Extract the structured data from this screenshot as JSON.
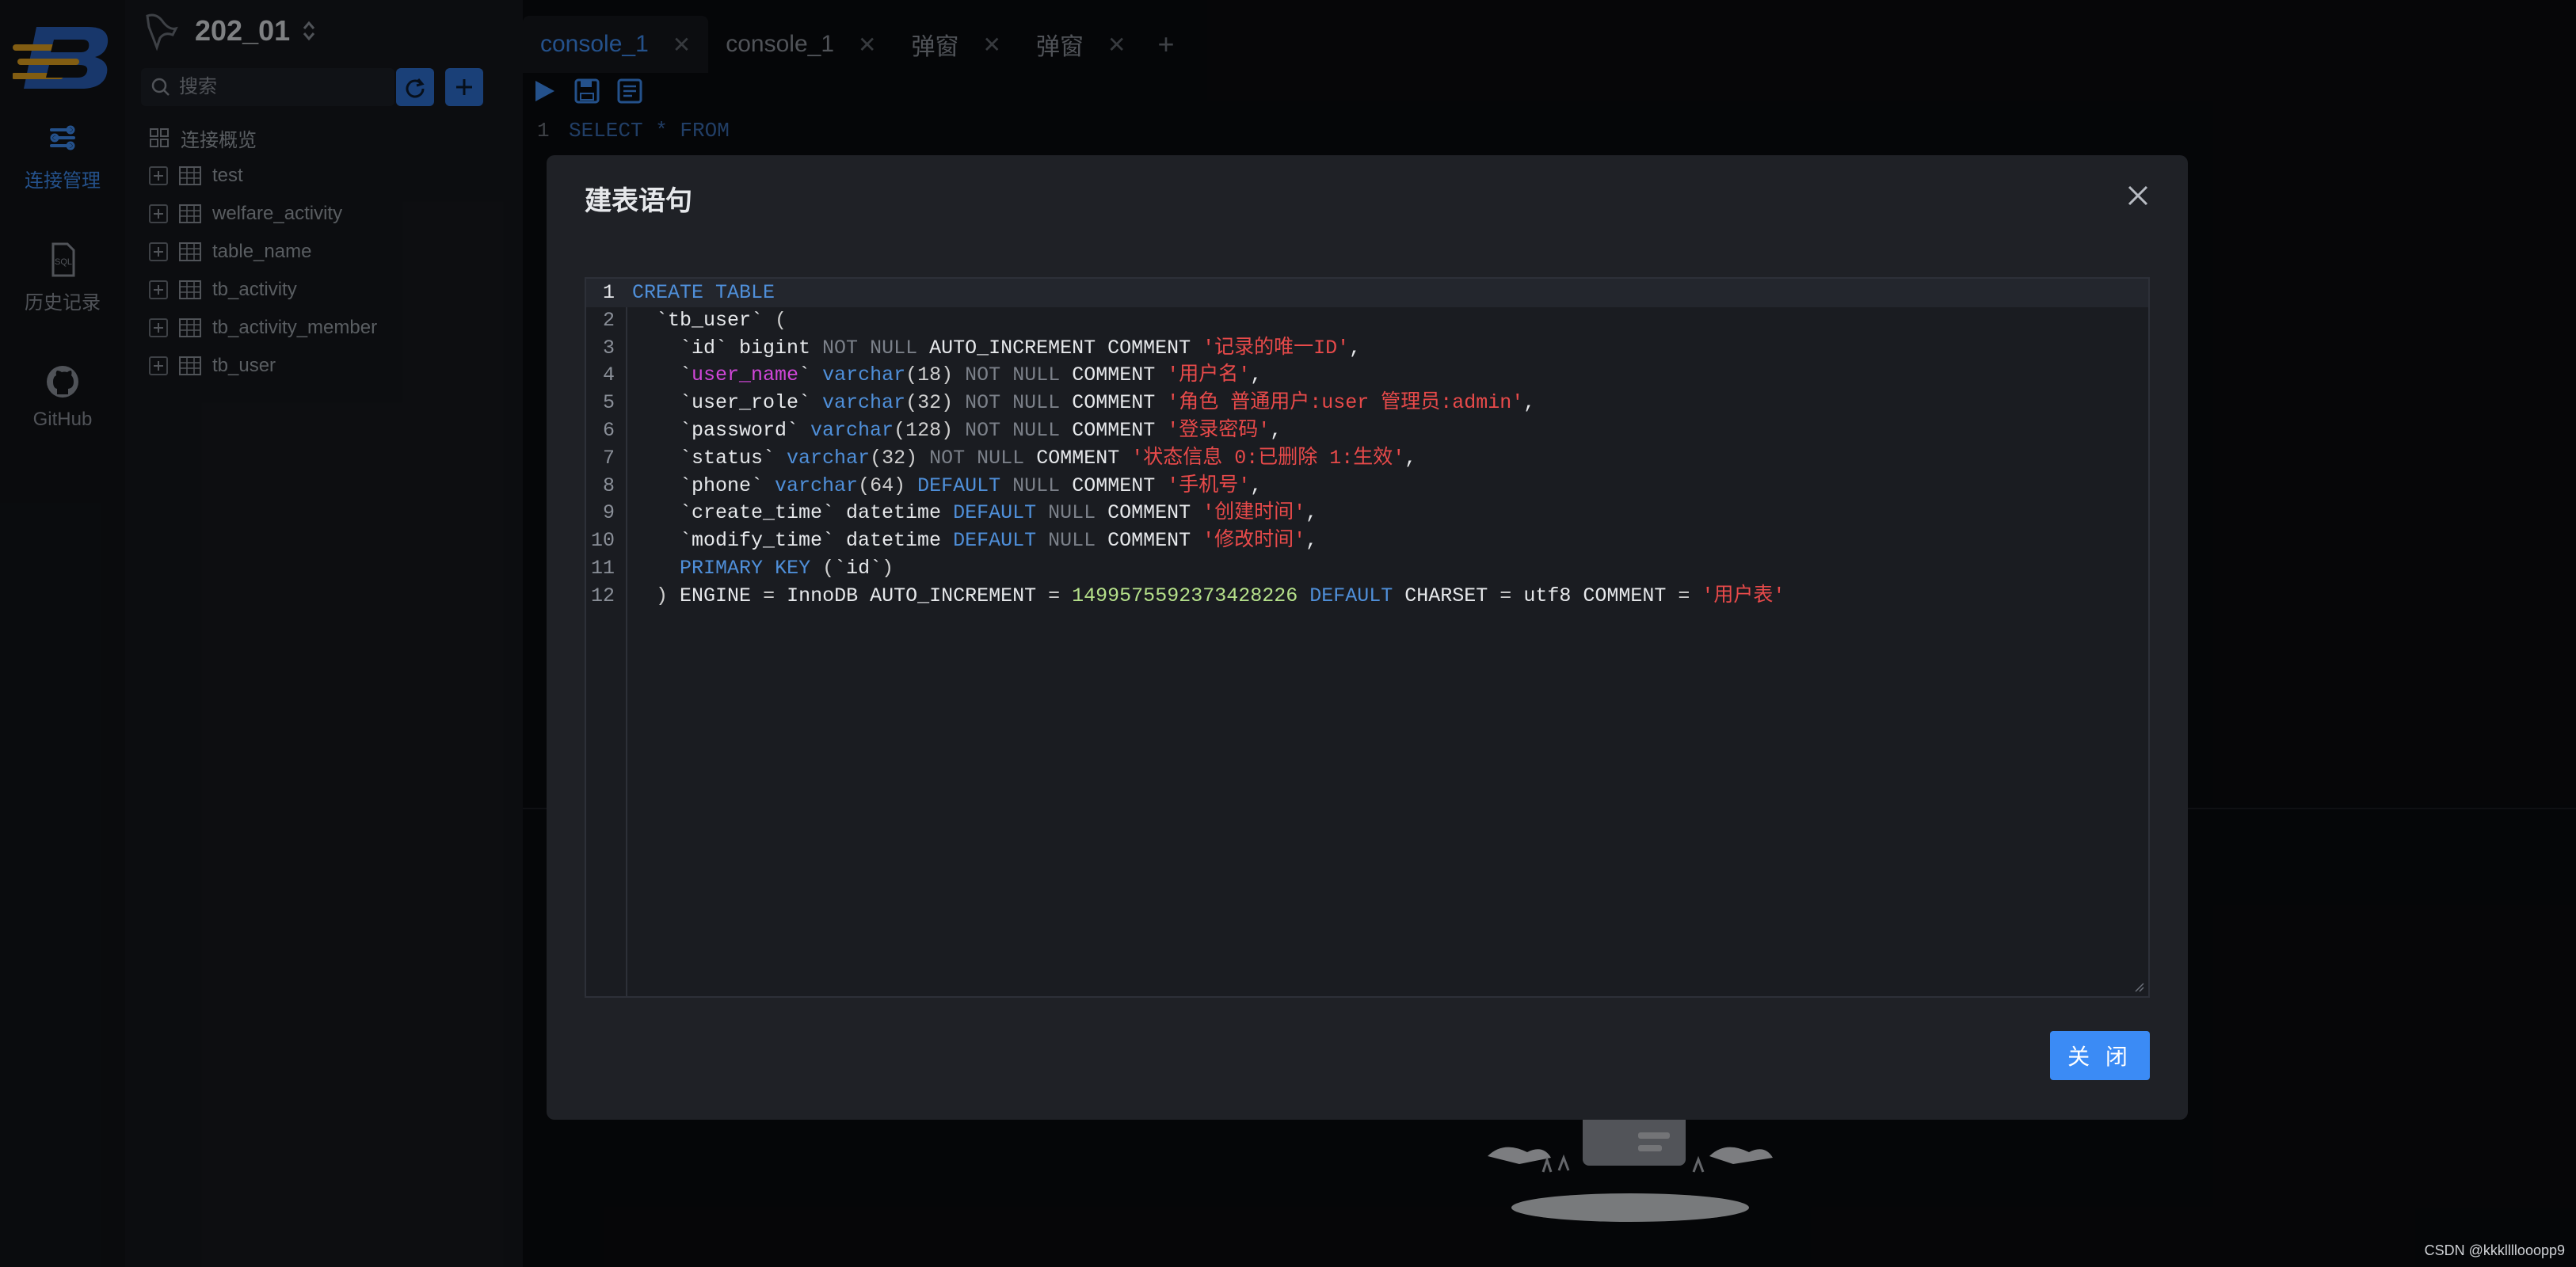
{
  "rail": {
    "items": [
      {
        "label": "连接管理",
        "icon": "connection-icon",
        "active": true
      },
      {
        "label": "历史记录",
        "icon": "sql-history-icon",
        "active": false
      },
      {
        "label": "GitHub",
        "icon": "github-icon",
        "active": false
      }
    ]
  },
  "sidebar": {
    "db_name": "202_01",
    "search_placeholder": "搜索",
    "overview_label": "连接概览",
    "tables": [
      "test",
      "welfare_activity",
      "table_name",
      "tb_activity",
      "tb_activity_member",
      "tb_user"
    ]
  },
  "tabs": [
    {
      "label": "console_1",
      "active": true
    },
    {
      "label": "console_1",
      "active": false
    },
    {
      "label": "弹窗",
      "active": false
    },
    {
      "label": "弹窗",
      "active": false
    }
  ],
  "background_editor": {
    "line_no": "1",
    "code": "SELECT * FROM"
  },
  "modal": {
    "title": "建表语句",
    "close_button": "关 闭",
    "code_lines": [
      "CREATE TABLE",
      "  `tb_user` (",
      "    `id` bigint NOT NULL AUTO_INCREMENT COMMENT '记录的唯一ID',",
      "    `user_name` varchar(18) NOT NULL COMMENT '用户名',",
      "    `user_role` varchar(32) NOT NULL COMMENT '角色 普通用户:user 管理员:admin',",
      "    `password` varchar(128) NOT NULL COMMENT '登录密码',",
      "    `status` varchar(32) NOT NULL COMMENT '状态信息 0:已删除 1:生效',",
      "    `phone` varchar(64) DEFAULT NULL COMMENT '手机号',",
      "    `create_time` datetime DEFAULT NULL COMMENT '创建时间',",
      "    `modify_time` datetime DEFAULT NULL COMMENT '修改时间',",
      "    PRIMARY KEY (`id`)",
      "  ) ENGINE = InnoDB AUTO_INCREMENT = 1499575592373428226 DEFAULT CHARSET = utf8 COMMENT = '用户表'"
    ]
  },
  "watermark": "CSDN @kkkllllooopp9",
  "colors": {
    "accent": "#3b8bf5",
    "keyword": "#4f8fd9",
    "string": "#e84a4a",
    "number": "#b5e08a"
  }
}
